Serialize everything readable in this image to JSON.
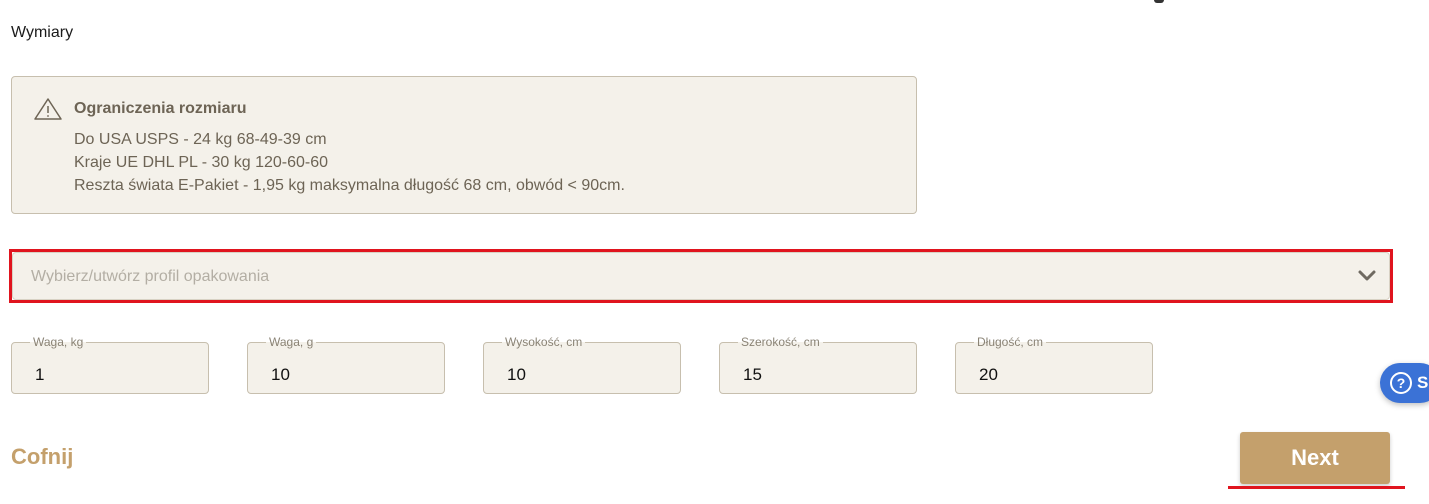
{
  "section": {
    "title": "Wymiary"
  },
  "notice": {
    "icon": "warning-triangle-icon",
    "title": "Ograniczenia rozmiaru",
    "lines": [
      "Do USA USPS - 24 kg 68-49-39 cm",
      "Kraje UE DHL PL - 30 kg 120-60-60",
      "Reszta świata E-Pakiet - 1,95 kg maksymalna długość 68 cm, obwód < 90cm."
    ]
  },
  "package_profile": {
    "placeholder": "Wybierz/utwórz profil opakowania",
    "icon": "chevron-down-icon"
  },
  "fields": [
    {
      "label": "Waga, kg",
      "value": "1"
    },
    {
      "label": "Waga, g",
      "value": "10"
    },
    {
      "label": "Wysokość, cm",
      "value": "10"
    },
    {
      "label": "Szerokość, cm",
      "value": "15"
    },
    {
      "label": "Długość, cm",
      "value": "20"
    }
  ],
  "help": {
    "icon": "question-circle-icon",
    "label_visible": "S"
  },
  "actions": {
    "back_label": "Cofnij",
    "next_label": "Next"
  },
  "colors": {
    "accent": "#c4a06c",
    "highlight": "#e0141e",
    "panel_bg": "#f4f1ea",
    "help_blue": "#3b72d6"
  }
}
